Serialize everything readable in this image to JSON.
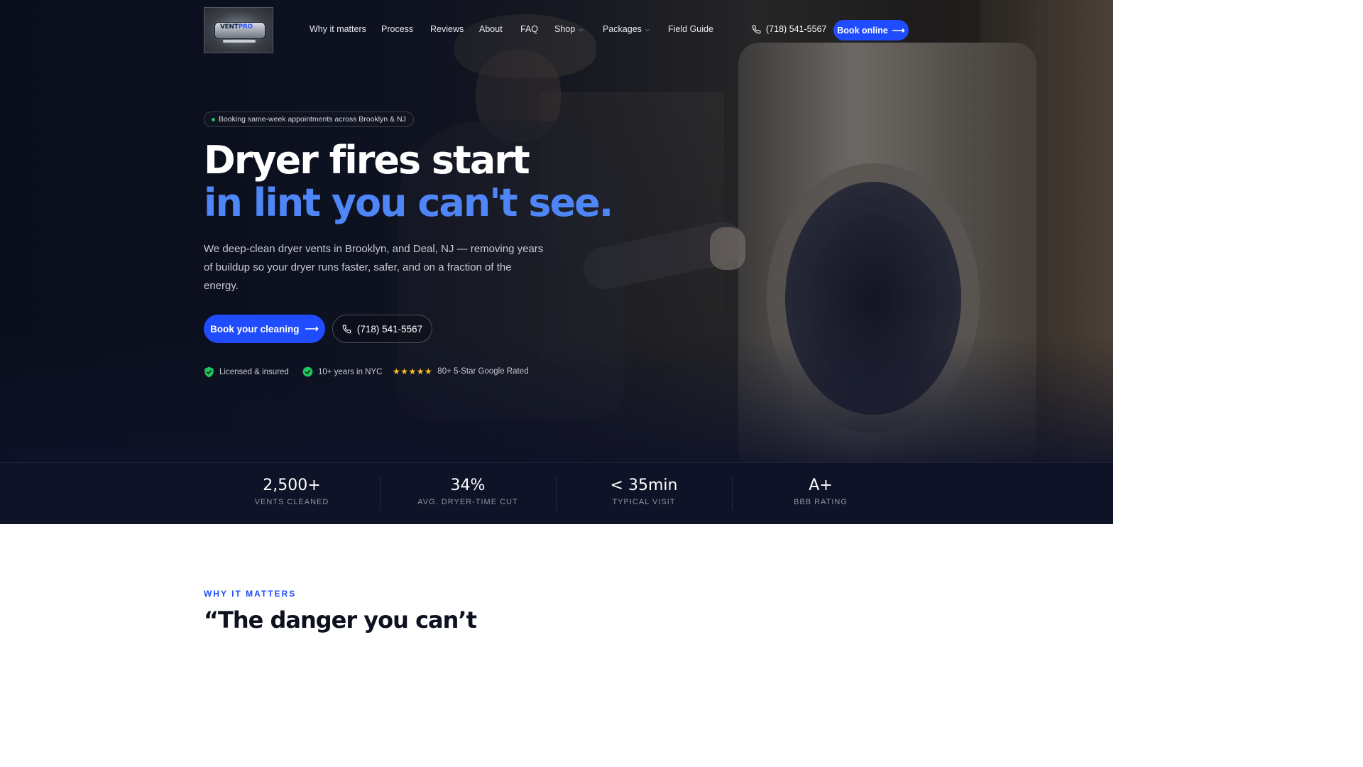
{
  "brand": {
    "logo_text_a": "VENT",
    "logo_text_b": "PRO"
  },
  "nav": {
    "links": [
      {
        "label": "Why it matters",
        "has_caret": false
      },
      {
        "label": "Process",
        "has_caret": false
      },
      {
        "label": "Reviews",
        "has_caret": false
      },
      {
        "label": "About",
        "has_caret": false
      },
      {
        "label": "FAQ",
        "has_caret": false
      },
      {
        "label": "Shop",
        "has_caret": true
      },
      {
        "label": "Packages",
        "has_caret": true
      },
      {
        "label": "Field Guide",
        "has_caret": false
      }
    ],
    "phone": "(718) 541-5567",
    "cta": "Book online"
  },
  "hero": {
    "pill": "Booking same-week appointments across Brooklyn & NJ",
    "headline_line1": "Dryer fires start",
    "headline_line2": "in lint you can't see.",
    "lede": "We deep-clean dryer vents in Brooklyn, and Deal, NJ — removing years of buildup so your dryer runs faster, safer, and on a fraction of the energy.",
    "primary_cta": "Book your cleaning",
    "secondary_cta": "(718) 541-5567",
    "trust": [
      {
        "icon": "shield-check-icon",
        "label": "Licensed & insured"
      },
      {
        "icon": "check-circle-icon",
        "label": "10+ years in NYC"
      },
      {
        "icon": "stars-icon",
        "label": "80+ 5-Star Google Rated",
        "stars": "★★★★★"
      }
    ]
  },
  "stats": [
    {
      "value": "2,500+",
      "label": "VENTS CLEANED"
    },
    {
      "value": "34%",
      "label": "AVG. DRYER-TIME CUT"
    },
    {
      "value": "< 35min",
      "label": "TYPICAL VISIT"
    },
    {
      "value": "A+",
      "label": "BBB RATING"
    }
  ],
  "why": {
    "eyebrow": "WHY IT MATTERS",
    "heading": "“The danger you can’t"
  },
  "colors": {
    "accent": "#1f4cff",
    "headline_accent": "#4f86f7",
    "stats_bg": "#0f1327",
    "success": "#22c55e",
    "star": "#fbbf24"
  }
}
